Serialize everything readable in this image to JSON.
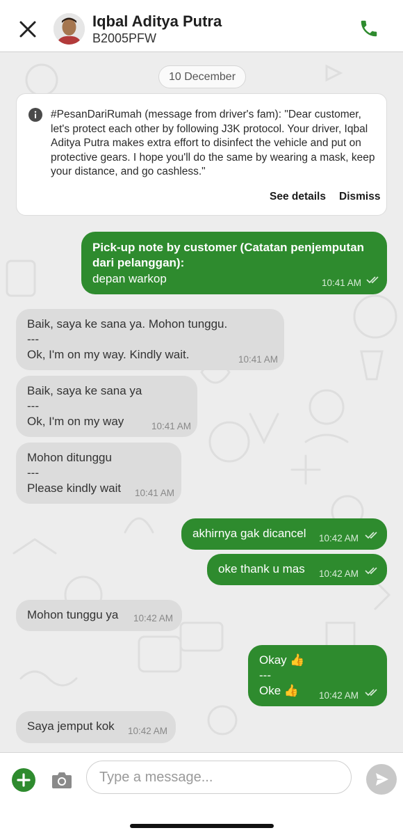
{
  "header": {
    "driver_name": "Iqbal Aditya Putra",
    "plate": "B2005PFW"
  },
  "chat": {
    "date_chip": "10 December",
    "info_card": {
      "text": "#PesanDariRumah (message from driver's fam): \"Dear customer, let's protect each other by following J3K protocol. Your driver, Iqbal Aditya Putra makes extra effort to disinfect the vehicle and put on protective gears. I hope you'll do the same by wearing a mask, keep your distance, and go cashless.\"",
      "see_details": "See details",
      "dismiss": "Dismiss"
    },
    "messages": [
      {
        "title": "Pick-up note by customer (Catatan penjemputan dari pelanggan):",
        "text": "depan warkop",
        "time": "10:41 AM"
      },
      {
        "text": "Baik, saya ke sana ya. Mohon tunggu.\n---\nOk, I'm on my way. Kindly wait.",
        "time": "10:41 AM"
      },
      {
        "text": "Baik, saya ke sana ya\n---\nOk, I'm on my way",
        "time": "10:41 AM"
      },
      {
        "text": "Mohon ditunggu\n---\nPlease kindly wait",
        "time": "10:41 AM"
      },
      {
        "text": "akhirnya gak dicancel",
        "time": "10:42 AM"
      },
      {
        "text": "oke thank u mas",
        "time": "10:42 AM"
      },
      {
        "text": "Mohon tunggu ya",
        "time": "10:42 AM"
      },
      {
        "text": "Okay 👍\n---\nOke 👍",
        "time": "10:42 AM"
      },
      {
        "text": "Saya jemput kok",
        "time": "10:42 AM"
      }
    ]
  },
  "input_bar": {
    "placeholder": "Type a message..."
  },
  "colors": {
    "outgoing_bubble": "#2e8b2e",
    "incoming_bubble": "#dcdcdc",
    "call_icon": "#2e8b2e"
  }
}
